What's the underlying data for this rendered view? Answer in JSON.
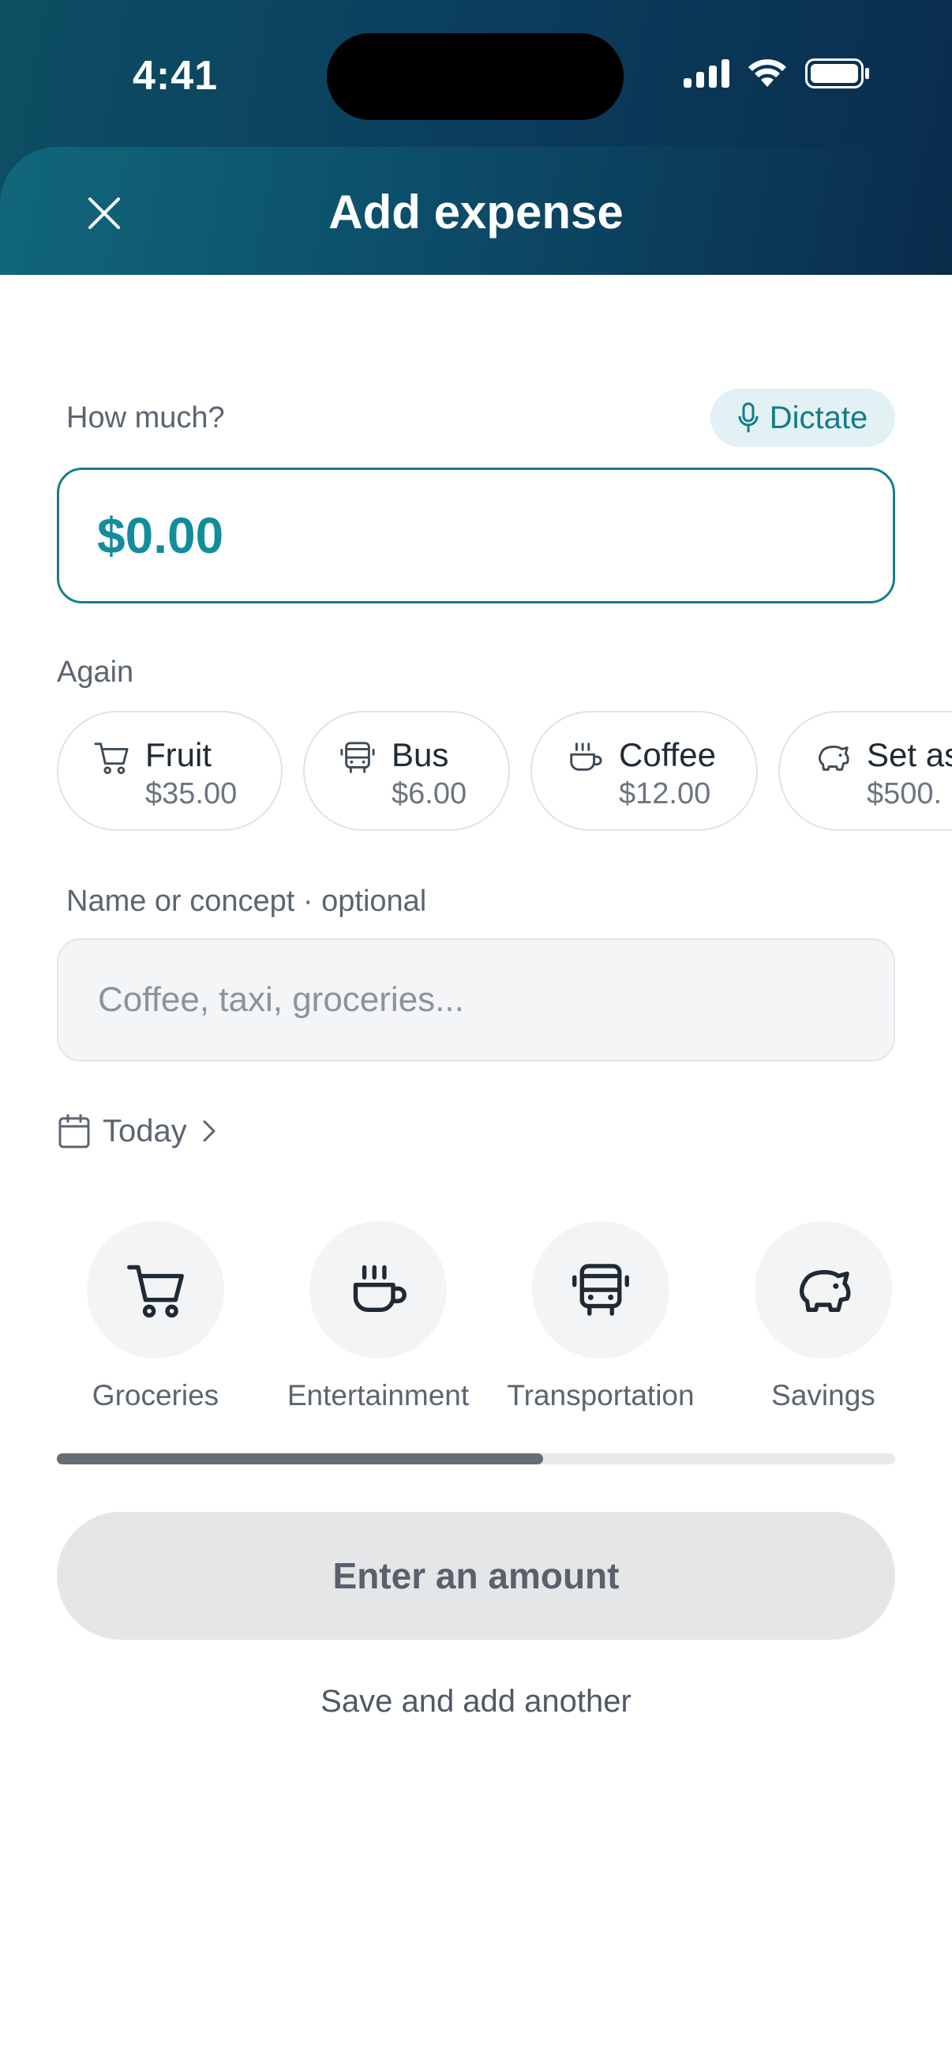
{
  "status_bar": {
    "time": "4:41"
  },
  "header": {
    "title": "Add expense"
  },
  "amount": {
    "label": "How much?",
    "value": "$0.00",
    "dictate_label": "Dictate"
  },
  "again": {
    "label": "Again",
    "chips": [
      {
        "name": "Fruit",
        "amount": "$35.00",
        "icon": "cart-icon"
      },
      {
        "name": "Bus",
        "amount": "$6.00",
        "icon": "bus-icon"
      },
      {
        "name": "Coffee",
        "amount": "$12.00",
        "icon": "coffee-icon"
      },
      {
        "name": "Set as",
        "amount": "$500.",
        "icon": "piggy-bank-icon"
      }
    ]
  },
  "name_field": {
    "label": "Name or concept · optional",
    "placeholder": "Coffee, taxi, groceries..."
  },
  "date": {
    "label": "Today"
  },
  "categories": [
    {
      "label": "Groceries",
      "icon": "cart-icon"
    },
    {
      "label": "Entertainment",
      "icon": "coffee-icon"
    },
    {
      "label": "Transportation",
      "icon": "bus-icon"
    },
    {
      "label": "Savings",
      "icon": "piggy-bank-icon"
    }
  ],
  "category_scroll": {
    "visible_fraction": 0.58
  },
  "actions": {
    "primary": "Enter an amount",
    "secondary": "Save and add another"
  },
  "colors": {
    "accent": "#138c9c",
    "header_dark": "#0a2d4e",
    "header_teal": "#11677b"
  }
}
